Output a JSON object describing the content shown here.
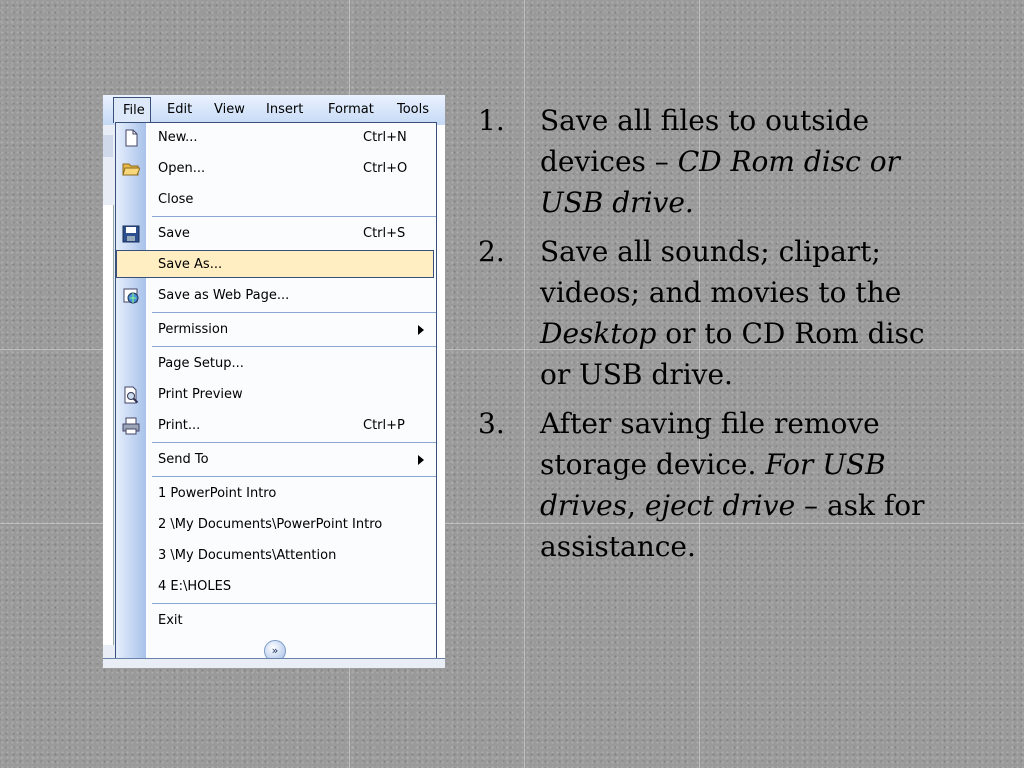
{
  "menu_bar": [
    "File",
    "Edit",
    "View",
    "Insert",
    "Format",
    "Tools"
  ],
  "menu_items": [
    {
      "label": "New...",
      "shortcut": "Ctrl+N",
      "icon": "new-document-icon"
    },
    {
      "label": "Open...",
      "shortcut": "Ctrl+O",
      "icon": "open-folder-icon"
    },
    {
      "label": "Close",
      "shortcut": ""
    },
    {
      "label": "Save",
      "shortcut": "Ctrl+S",
      "icon": "floppy-disk-icon"
    },
    {
      "label": "Save As...",
      "shortcut": "",
      "highlighted": true
    },
    {
      "label": "Save as Web Page...",
      "shortcut": "",
      "icon": "web-page-icon"
    },
    {
      "label": "Permission",
      "shortcut": "",
      "submenu": true
    },
    {
      "label": "Page Setup...",
      "shortcut": ""
    },
    {
      "label": "Print Preview",
      "shortcut": "",
      "icon": "print-preview-icon"
    },
    {
      "label": "Print...",
      "shortcut": "Ctrl+P",
      "icon": "printer-icon"
    },
    {
      "label": "Send To",
      "shortcut": "",
      "submenu": true
    },
    {
      "label": "1 PowerPoint Intro",
      "shortcut": ""
    },
    {
      "label": "2 \\My Documents\\PowerPoint Intro",
      "shortcut": ""
    },
    {
      "label": "3 \\My Documents\\Attention",
      "shortcut": ""
    },
    {
      "label": "4 E:\\HOLES",
      "shortcut": ""
    },
    {
      "label": "Exit",
      "shortcut": ""
    }
  ],
  "expand_chevron": "»",
  "list": [
    {
      "num": "1.",
      "parts": [
        {
          "t": "Save all files to outside devices – ",
          "i": false
        },
        {
          "t": "CD Rom disc or USB drive.",
          "i": true
        }
      ]
    },
    {
      "num": "2.",
      "parts": [
        {
          "t": "Save all sounds; clipart; videos; and movies to the ",
          "i": false
        },
        {
          "t": "Desktop",
          "i": true
        },
        {
          "t": " or to CD Rom disc or USB drive.",
          "i": false
        }
      ]
    },
    {
      "num": "3.",
      "parts": [
        {
          "t": "After saving file remove storage device.  ",
          "i": false
        },
        {
          "t": "For USB drives",
          "i": true
        },
        {
          "t": ", ",
          "i": false
        },
        {
          "t": "eject drive",
          "i": true
        },
        {
          "t": " – ask for assistance.",
          "i": false
        }
      ]
    }
  ]
}
